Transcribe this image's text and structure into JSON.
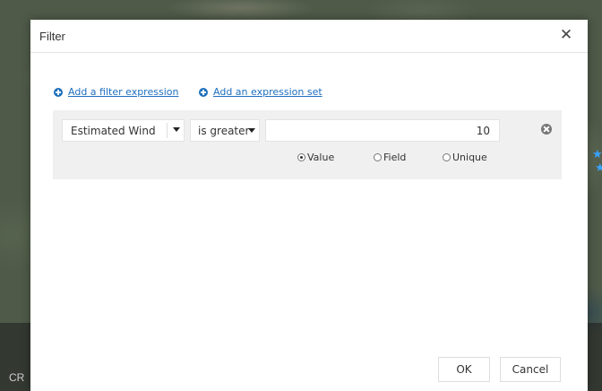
{
  "colors": {
    "accent": "#1d6fbc",
    "panel": "#f0f0f0",
    "map_star": "#39a4ff"
  },
  "map": {
    "attribution_fragment": "CR"
  },
  "dialog": {
    "title": "Filter",
    "close_icon": "close-icon"
  },
  "actions": {
    "add_filter_expression": "Add a filter expression",
    "add_expression_set": "Add an expression set",
    "add_icon": "plus-circle-icon"
  },
  "expression": {
    "field": "Estimated Wind",
    "operator": "is greater than",
    "value": "10",
    "remove_icon": "remove-circle-icon",
    "value_types": [
      {
        "label": "Value",
        "checked": true
      },
      {
        "label": "Field",
        "checked": false
      },
      {
        "label": "Unique",
        "checked": false
      }
    ]
  },
  "footer": {
    "ok_label": "OK",
    "cancel_label": "Cancel"
  }
}
